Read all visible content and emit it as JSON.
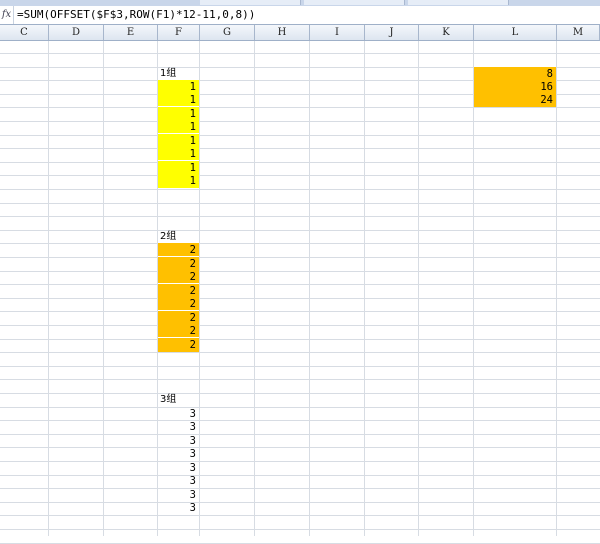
{
  "formula_bar": {
    "fx_icon": "fx-icon",
    "formula": "=SUM(OFFSET($F$3,ROW(F1)*12-11,0,8))"
  },
  "columns": [
    "C",
    "D",
    "E",
    "F",
    "G",
    "H",
    "I",
    "J",
    "K",
    "L",
    "M"
  ],
  "sheet": {
    "group1": {
      "label": "1组",
      "values": [
        "1",
        "1",
        "1",
        "1",
        "1",
        "1",
        "1",
        "1"
      ],
      "fill": "#ffff00"
    },
    "group2": {
      "label": "2组",
      "values": [
        "2",
        "2",
        "2",
        "2",
        "2",
        "2",
        "2",
        "2"
      ],
      "fill": "#ffc000"
    },
    "group3": {
      "label": "3组",
      "values": [
        "3",
        "3",
        "3",
        "3",
        "3",
        "3",
        "3",
        "3"
      ],
      "fill": "#ffffff"
    },
    "results": {
      "values": [
        "8",
        "16",
        "24"
      ],
      "fill": "#ffc000"
    }
  }
}
